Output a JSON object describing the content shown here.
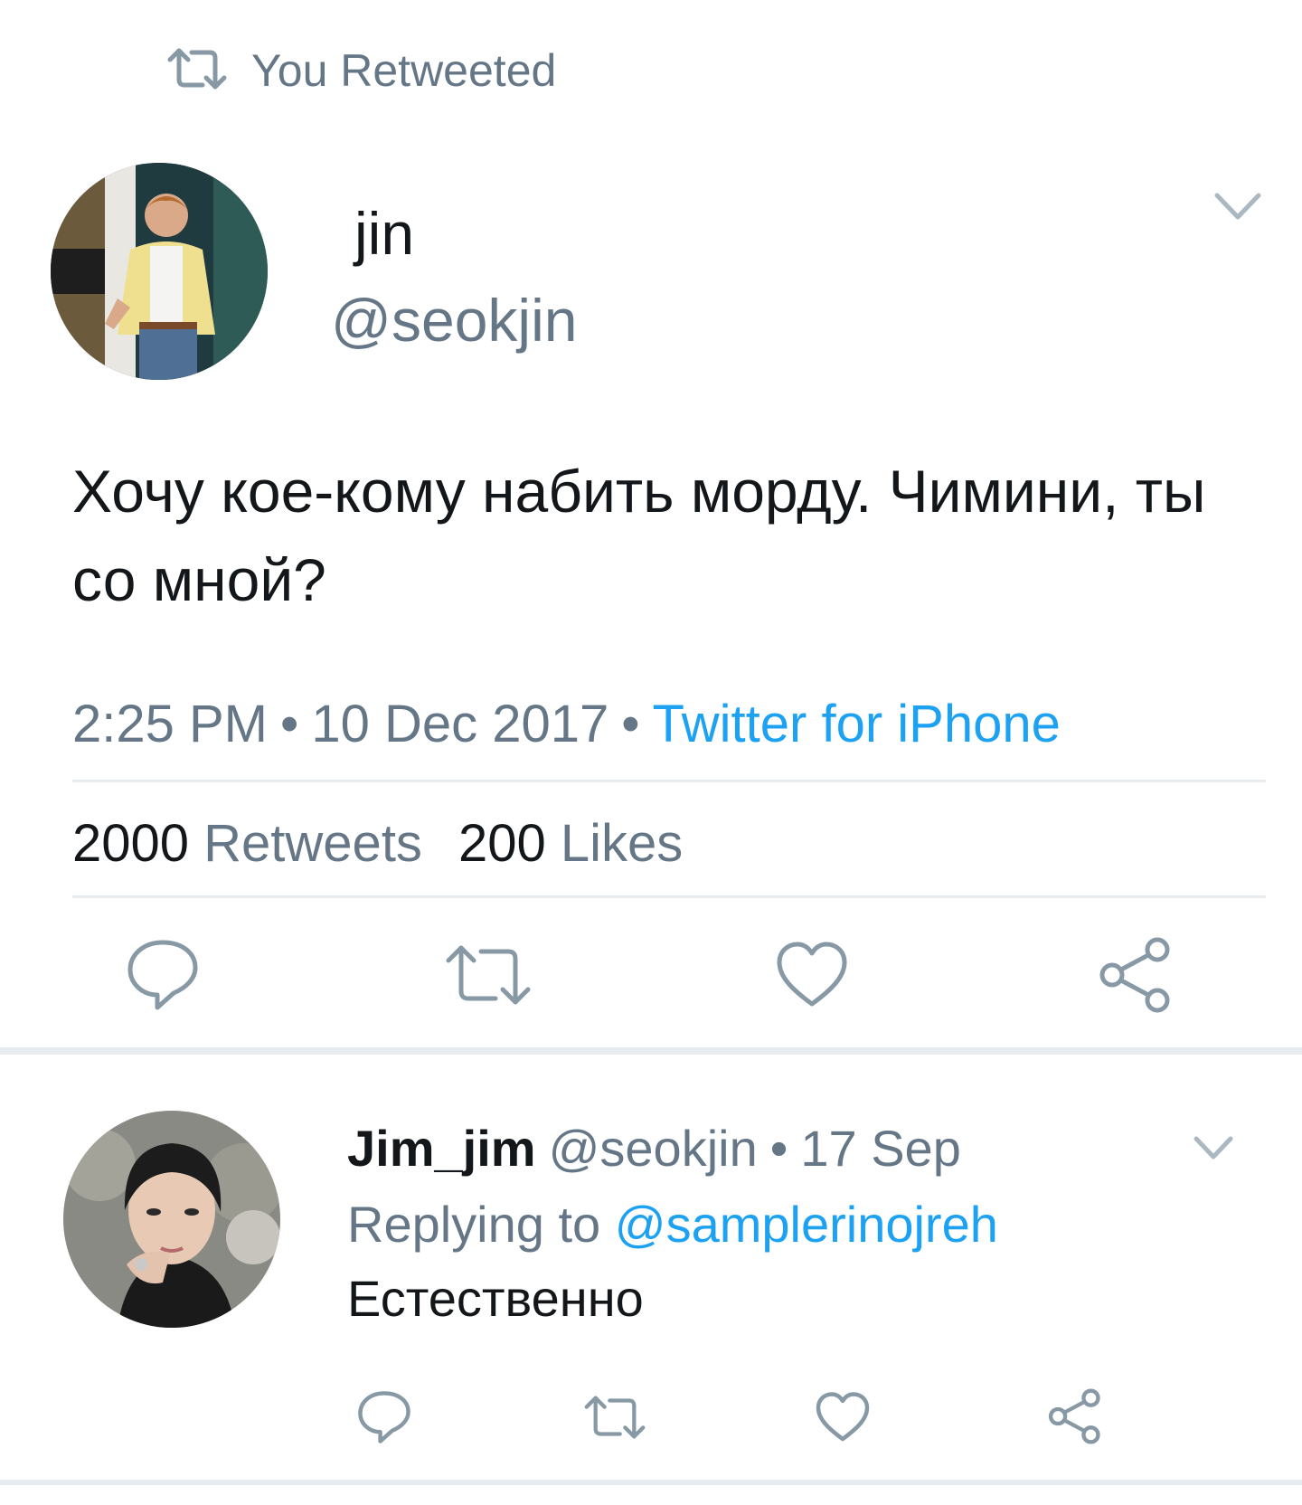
{
  "retweet_header": {
    "label": "You Retweeted",
    "icon": "retweet-icon"
  },
  "tweet": {
    "author_name": "jin",
    "author_handle": "@seokjin",
    "text": " Хочу кое-кому набить морду. Чимини, ты со мной?",
    "time": "2:25 PM",
    "date": "10 Dec 2017",
    "separator": "•",
    "source": "Twitter for iPhone",
    "stats": {
      "retweets_count": "2000",
      "retweets_label": "Retweets",
      "likes_count": "200",
      "likes_label": "Likes"
    },
    "actions": [
      "reply-icon",
      "retweet-icon",
      "heart-icon",
      "share-icon"
    ]
  },
  "reply": {
    "author_name": "Jim_jim",
    "author_handle": "@seokjin",
    "separator": "•",
    "date": "17 Sep",
    "replying_prefix": "Replying to",
    "replying_to": "@samplerinojreh",
    "text": "Естественно",
    "actions": [
      "reply-icon",
      "retweet-icon",
      "heart-icon",
      "share-icon"
    ]
  },
  "colors": {
    "text_primary": "#14171a",
    "text_secondary": "#657786",
    "link": "#1da1f2",
    "divider": "#e6ecf0",
    "icon": "#8899a6"
  }
}
